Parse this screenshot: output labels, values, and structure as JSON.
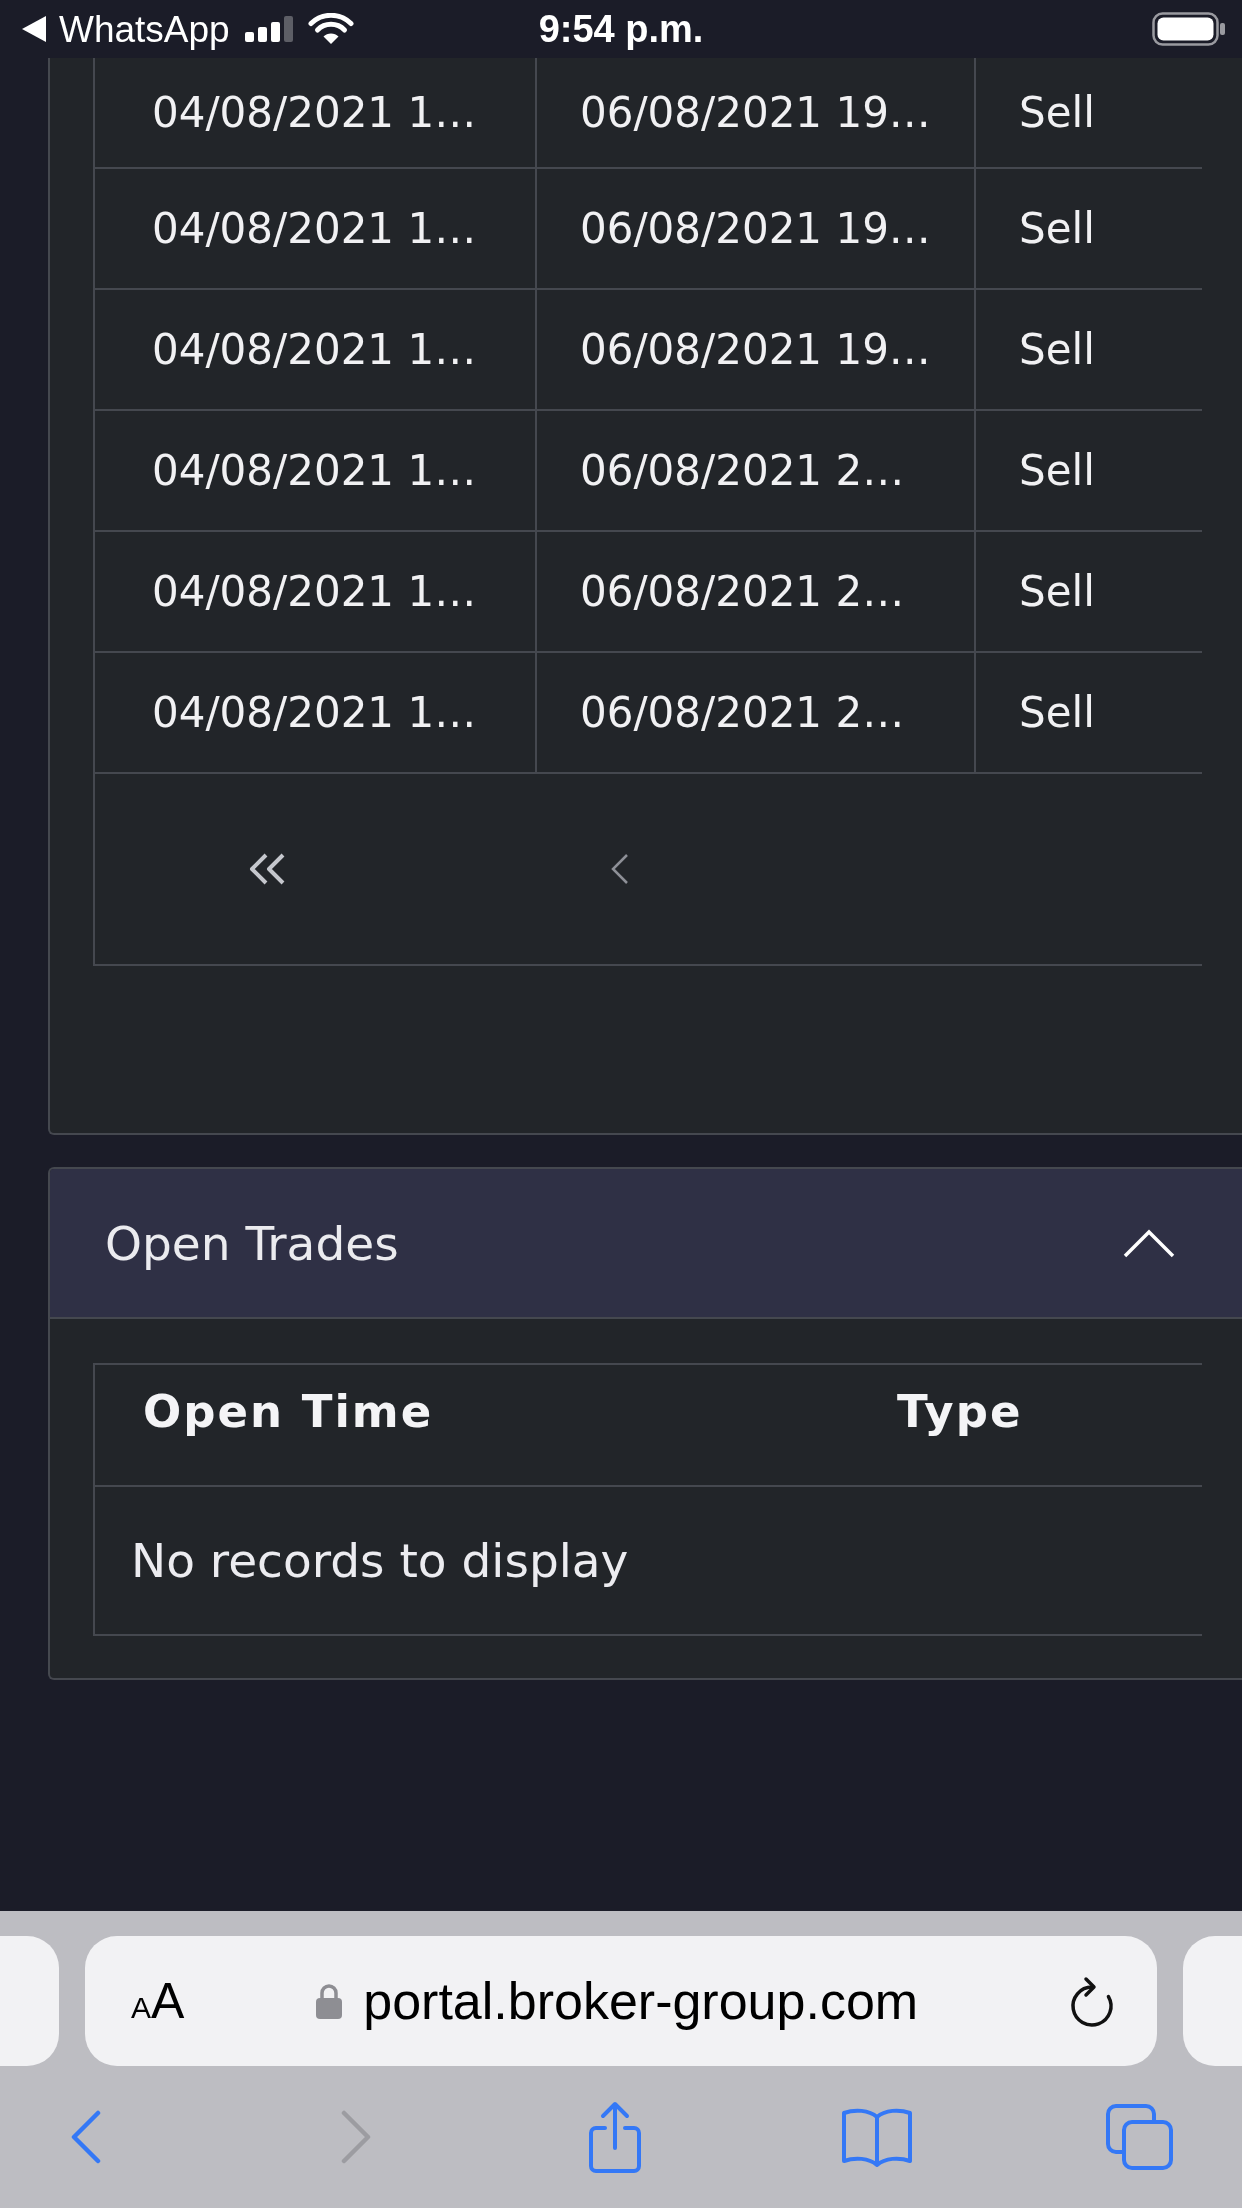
{
  "status_bar": {
    "back_app": "WhatsApp",
    "time": "9:54 p.m."
  },
  "table": {
    "rows": [
      [
        "04/08/2021 1…",
        "06/08/2021 19…",
        "Sell"
      ],
      [
        "04/08/2021 1…",
        "06/08/2021 19…",
        "Sell"
      ],
      [
        "04/08/2021 1…",
        "06/08/2021 19…",
        "Sell"
      ],
      [
        "04/08/2021 1…",
        "06/08/2021 2…",
        "Sell"
      ],
      [
        "04/08/2021 1…",
        "06/08/2021 2…",
        "Sell"
      ],
      [
        "04/08/2021 1…",
        "06/08/2021 2…",
        "Sell"
      ]
    ]
  },
  "open_trades": {
    "title": "Open Trades",
    "expanded": true,
    "columns": [
      "Open Time",
      "Type"
    ],
    "empty_message": "No records to display"
  },
  "browser": {
    "text_size": "AA",
    "url": "portal.broker-group.com",
    "secure": true,
    "toolbar": [
      {
        "kind": "back",
        "disabled": false
      },
      {
        "kind": "forward",
        "disabled": true
      },
      {
        "kind": "share",
        "disabled": false
      },
      {
        "kind": "bookmarks",
        "disabled": false
      },
      {
        "kind": "tabs",
        "disabled": false
      }
    ]
  }
}
